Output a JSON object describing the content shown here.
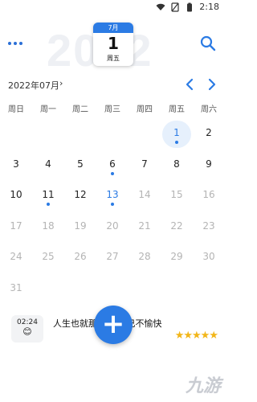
{
  "status_bar": {
    "time": "2:18"
  },
  "header": {
    "year_watermark": "2022",
    "date_card": {
      "month": "7月",
      "day": "1",
      "weekday": "周五"
    }
  },
  "month_bar": {
    "label": "2022年07月"
  },
  "weekdays": [
    "周日",
    "周一",
    "周二",
    "周三",
    "周四",
    "周五",
    "周六"
  ],
  "calendar": {
    "cells": [
      {
        "d": "",
        "t": "empty"
      },
      {
        "d": "",
        "t": "empty"
      },
      {
        "d": "",
        "t": "empty"
      },
      {
        "d": "",
        "t": "empty"
      },
      {
        "d": "",
        "t": "empty"
      },
      {
        "d": "1",
        "t": "selected",
        "dot": true
      },
      {
        "d": "2",
        "t": "cur"
      },
      {
        "d": "3",
        "t": "cur"
      },
      {
        "d": "4",
        "t": "cur"
      },
      {
        "d": "5",
        "t": "cur"
      },
      {
        "d": "6",
        "t": "cur",
        "dot": true
      },
      {
        "d": "7",
        "t": "cur"
      },
      {
        "d": "8",
        "t": "cur"
      },
      {
        "d": "9",
        "t": "cur"
      },
      {
        "d": "10",
        "t": "cur"
      },
      {
        "d": "11",
        "t": "cur",
        "dot": true
      },
      {
        "d": "12",
        "t": "cur"
      },
      {
        "d": "13",
        "t": "today",
        "dot": true
      },
      {
        "d": "14",
        "t": "dim"
      },
      {
        "d": "15",
        "t": "dim"
      },
      {
        "d": "16",
        "t": "dim"
      },
      {
        "d": "17",
        "t": "dim"
      },
      {
        "d": "18",
        "t": "dim"
      },
      {
        "d": "19",
        "t": "dim"
      },
      {
        "d": "20",
        "t": "dim"
      },
      {
        "d": "21",
        "t": "dim"
      },
      {
        "d": "22",
        "t": "dim"
      },
      {
        "d": "23",
        "t": "dim"
      },
      {
        "d": "24",
        "t": "dim"
      },
      {
        "d": "25",
        "t": "dim"
      },
      {
        "d": "26",
        "t": "dim"
      },
      {
        "d": "27",
        "t": "dim"
      },
      {
        "d": "28",
        "t": "dim"
      },
      {
        "d": "29",
        "t": "dim"
      },
      {
        "d": "30",
        "t": "dim"
      },
      {
        "d": "31",
        "t": "dim"
      }
    ]
  },
  "note": {
    "time": "02:24",
    "emoji": "😊",
    "text": "人生也就那   必让自己不愉快",
    "stars": "★★★★★"
  },
  "fab": {
    "label": "+"
  },
  "watermark": {
    "text": "九游"
  },
  "colors": {
    "accent": "#2b7be4",
    "star": "#f2b619"
  }
}
